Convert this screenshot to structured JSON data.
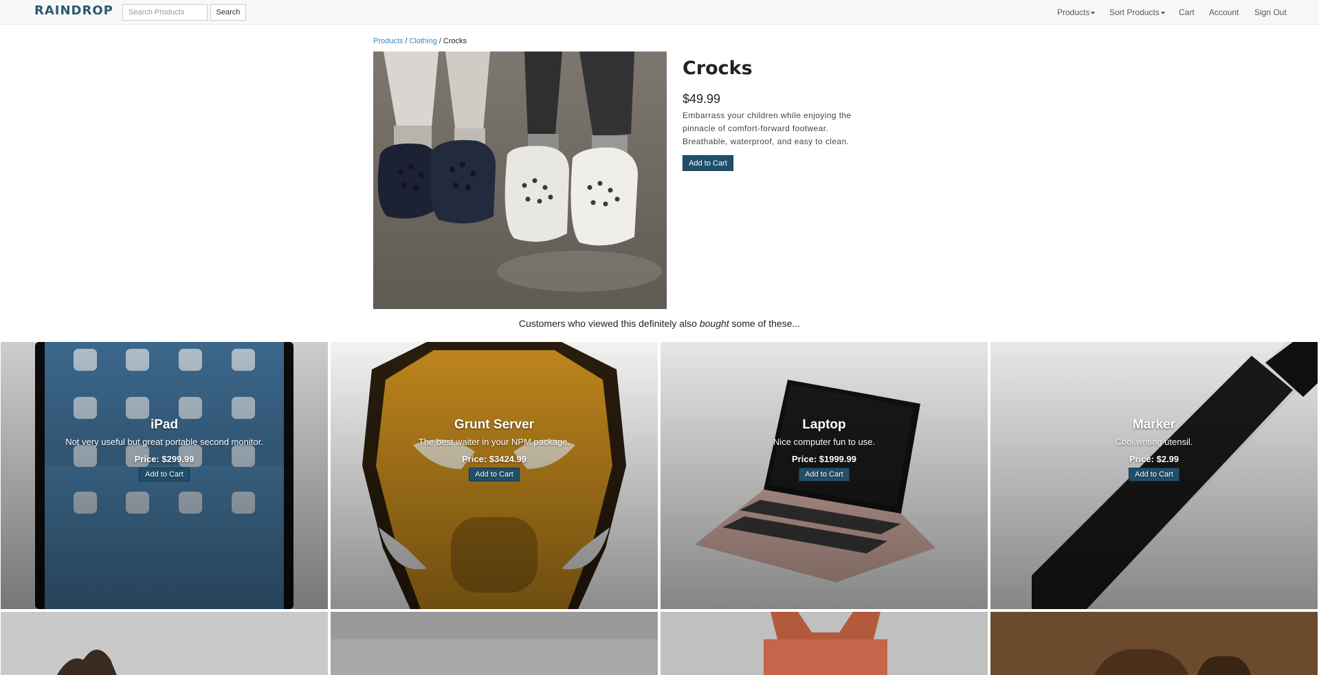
{
  "navbar": {
    "brand": "RAINDROP",
    "search_placeholder": "Search Products",
    "search_button": "Search",
    "menu": {
      "products": "Products",
      "sort_products": "Sort Products",
      "cart": "Cart",
      "account": "Account",
      "sign_out": "Sign Out"
    }
  },
  "breadcrumb": {
    "products": "Products",
    "clothing": "Clothing",
    "current": "Crocks",
    "separator": "/"
  },
  "product": {
    "title": "Crocks",
    "price": "$49.99",
    "description": "Embarrass your children while enjoying the pinnacle of comfort-forward footwear. Breathable, waterproof, and easy to clean.",
    "add_to_cart": "Add to Cart"
  },
  "recommendations": {
    "heading_before": "Customers who viewed this definitely also ",
    "heading_em": "bought",
    "heading_after": " some of these...",
    "items": [
      {
        "title": "iPad",
        "description": "Not very useful but great portable second monitor.",
        "price": "Price: $299.99",
        "button": "Add to Cart"
      },
      {
        "title": "Grunt Server",
        "description": "The best waiter in your NPM package.",
        "price": "Price: $3424.99",
        "button": "Add to Cart"
      },
      {
        "title": "Laptop",
        "description": "Nice computer fun to use.",
        "price": "Price: $1999.99",
        "button": "Add to Cart"
      },
      {
        "title": "Marker",
        "description": "Cool writing utensil.",
        "price": "Price: $2.99",
        "button": "Add to Cart"
      }
    ]
  },
  "colors": {
    "brand": "#2a5a73",
    "link": "#3a8ab0",
    "button": "#1f4f6b"
  }
}
